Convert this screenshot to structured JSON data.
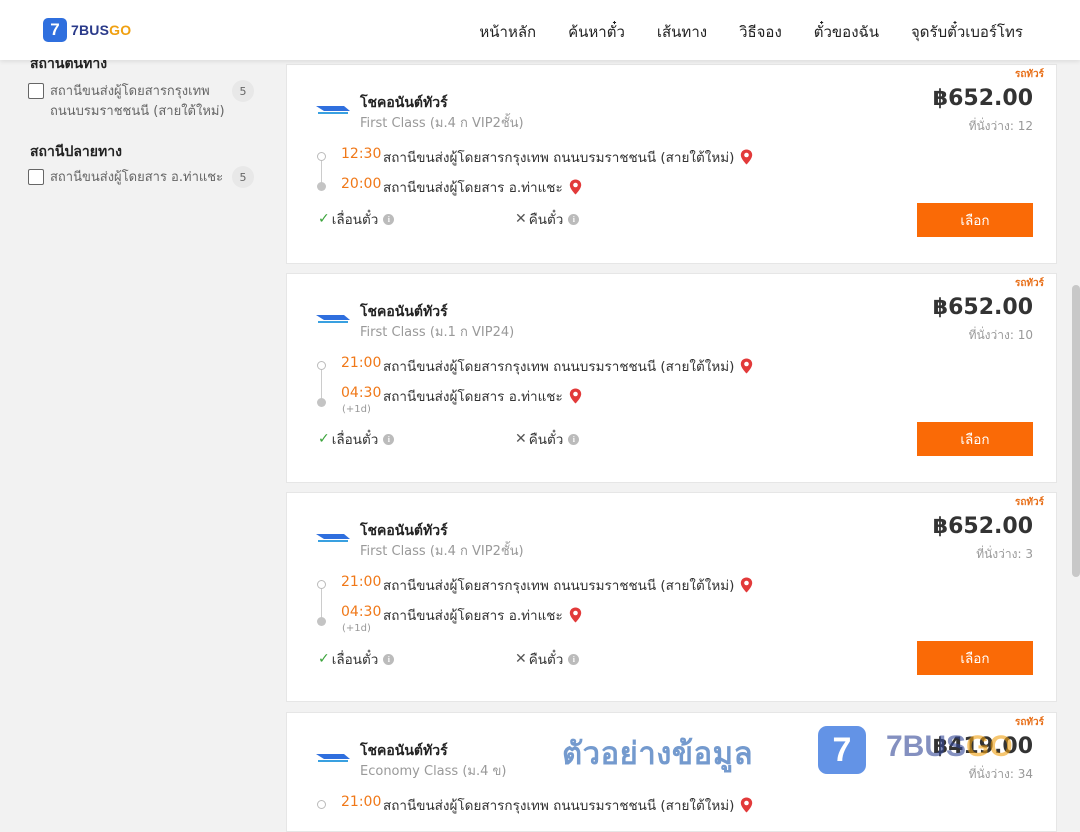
{
  "header": {
    "logo_badge": "7",
    "logo_text_a": "7BUS",
    "logo_text_b": "GO",
    "nav": [
      "หน้าหลัก",
      "ค้นหาตั๋ว",
      "เส้นทาง",
      "วิธีจอง",
      "ตั๋วของฉัน",
      "จุดรับตั๋วเบอร์โทร"
    ]
  },
  "sidebar": {
    "origin_heading": "สถานีต้นทาง",
    "origin_items": [
      {
        "label": "สถานีขนส่งผู้โดยสารกรุงเทพ ถนนบรมราชชนนี (สายใต้ใหม่)",
        "count": "5"
      }
    ],
    "dest_heading": "สถานีปลายทาง",
    "dest_items": [
      {
        "label": "สถานีขนส่งผู้โดยสาร อ.ท่าแชะ",
        "count": "5"
      }
    ]
  },
  "cards": [
    {
      "tag": "รถทัวร์",
      "operator": "โชคอนันต์ทัวร์",
      "class": "First Class (ม.4 ก VIP2ชั้น)",
      "price": "฿652.00",
      "seats": "ที่นั่งว่าง: 12",
      "depart_time": "12:30",
      "depart_station": "สถานีขนส่งผู้โดยสารกรุงเทพ ถนนบรมราชชนนี (สายใต้ใหม่)",
      "arrive_time": "20:00",
      "arrive_station": "สถานีขนส่งผู้โดยสาร อ.ท่าแชะ",
      "next_day": "",
      "reschedule": "เลื่อนตั๋ว",
      "refund": "คืนตั๋ว",
      "select": "เลือก"
    },
    {
      "tag": "รถทัวร์",
      "operator": "โชคอนันต์ทัวร์",
      "class": "First Class (ม.1 ก VIP24)",
      "price": "฿652.00",
      "seats": "ที่นั่งว่าง: 10",
      "depart_time": "21:00",
      "depart_station": "สถานีขนส่งผู้โดยสารกรุงเทพ ถนนบรมราชชนนี (สายใต้ใหม่)",
      "arrive_time": "04:30",
      "arrive_station": "สถานีขนส่งผู้โดยสาร อ.ท่าแชะ",
      "next_day": "(+1d)",
      "reschedule": "เลื่อนตั๋ว",
      "refund": "คืนตั๋ว",
      "select": "เลือก"
    },
    {
      "tag": "รถทัวร์",
      "operator": "โชคอนันต์ทัวร์",
      "class": "First Class (ม.4 ก VIP2ชั้น)",
      "price": "฿652.00",
      "seats": "ที่นั่งว่าง: 3",
      "depart_time": "21:00",
      "depart_station": "สถานีขนส่งผู้โดยสารกรุงเทพ ถนนบรมราชชนนี (สายใต้ใหม่)",
      "arrive_time": "04:30",
      "arrive_station": "สถานีขนส่งผู้โดยสาร อ.ท่าแชะ",
      "next_day": "(+1d)",
      "reschedule": "เลื่อนตั๋ว",
      "refund": "คืนตั๋ว",
      "select": "เลือก"
    },
    {
      "tag": "รถทัวร์",
      "operator": "โชคอนันต์ทัวร์",
      "class": "Economy Class (ม.4 ข)",
      "price": "฿419.00",
      "seats": "ที่นั่งว่าง: 34",
      "depart_time": "21:00",
      "depart_station": "สถานีขนส่งผู้โดยสารกรุงเทพ ถนนบรมราชชนนี (สายใต้ใหม่)"
    }
  ],
  "watermark": {
    "text": "ตัวอย่างข้อมูล",
    "badge": "7",
    "brand_a": "7BUS",
    "brand_b": "GO"
  },
  "colors": {
    "accent": "#fa6a06",
    "time": "#f07818",
    "brand_blue": "#2f6fde"
  }
}
